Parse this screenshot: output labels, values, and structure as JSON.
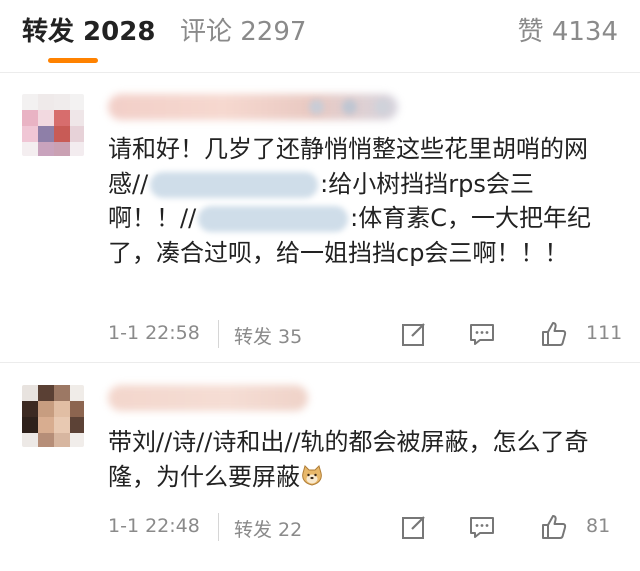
{
  "tabs": {
    "repost": "转发 2028",
    "comment": "评论 2297",
    "like": "赞 4134",
    "accent_color": "#ff8200"
  },
  "comments": [
    {
      "text_part1": "请和好！几岁了还静悄悄整这些花里胡哨的网感//",
      "text_part2": ":给小树挡挡rps会三啊！！//",
      "text_part3": ":体育素C，一大把年纪了，凑合过呗，给一姐挡挡cp会三啊！！！",
      "time": "1-1 22:58",
      "repost": "转发 35",
      "likes": "111"
    },
    {
      "text": "带刘//诗//诗和出//轨的都会被屏蔽，怎么了奇隆，为什么要屏蔽",
      "emoji": "doge-emoji",
      "time": "1-1 22:48",
      "repost": "转发 22",
      "likes": "81"
    }
  ],
  "icons": {
    "edit": "edit-icon",
    "comment": "comment-icon",
    "like": "thumbs-up-icon"
  }
}
